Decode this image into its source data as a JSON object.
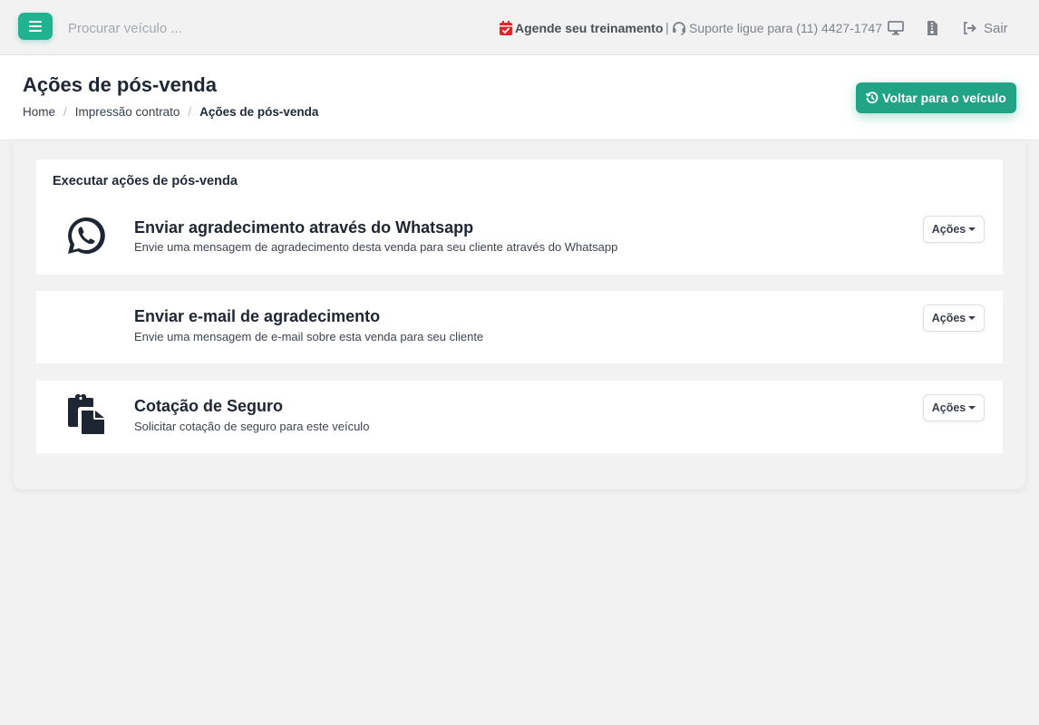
{
  "topbar": {
    "search_placeholder": "Procurar veículo ...",
    "training_label": "Agende seu treinamento",
    "pipe": "|",
    "support_label": "Suporte ligue para (11) 4427-1747",
    "logout_label": "Sair",
    "colors": {
      "brand": "#21b38f",
      "calendar": "#e0262b"
    }
  },
  "header": {
    "title": "Ações de pós-venda",
    "breadcrumb": [
      "Home",
      "Impressão contrato",
      "Ações de pós-venda"
    ],
    "breadcrumb_sep": "/",
    "back_button": "Voltar para o veículo"
  },
  "section": {
    "title": "Executar ações de pós-venda",
    "items": [
      {
        "icon": "whatsapp-icon",
        "title": "Enviar agradecimento através do Whatsapp",
        "description": "Envie uma mensagem de agradecimento desta venda para seu cliente através do Whatsapp",
        "action": "Ações"
      },
      {
        "icon": "",
        "title": "Enviar e-mail de agradecimento",
        "description": "Envie uma mensagem de e-mail sobre esta venda para seu cliente",
        "action": "Ações"
      },
      {
        "icon": "clipboard-icon",
        "title": "Cotação de Seguro",
        "description": "Solicitar cotação de seguro para este veículo",
        "action": "Ações"
      }
    ]
  }
}
